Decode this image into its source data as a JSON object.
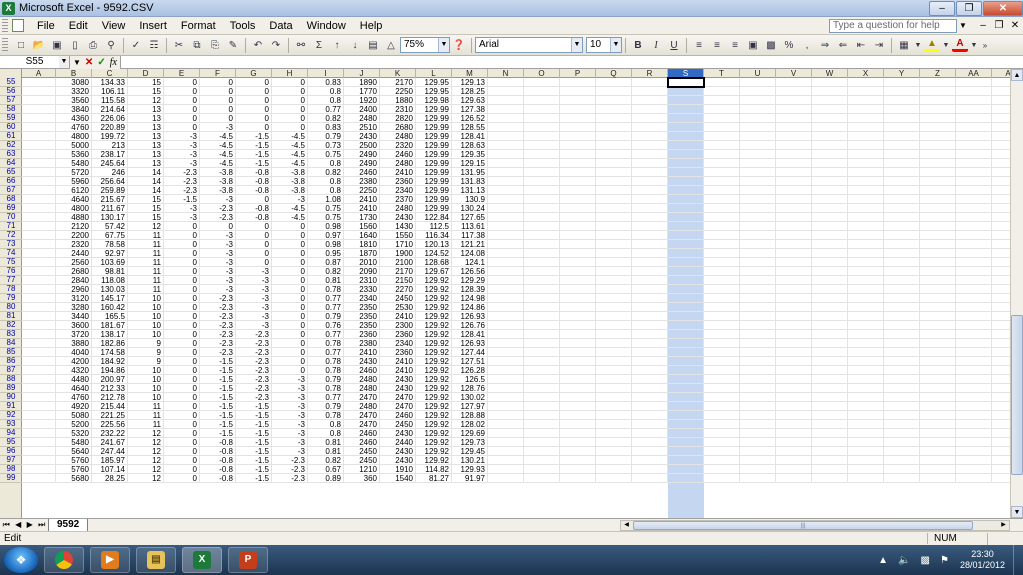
{
  "window": {
    "title": "Microsoft Excel - 9592.CSV",
    "icon": "excel-icon"
  },
  "menu": {
    "items": [
      "File",
      "Edit",
      "View",
      "Insert",
      "Format",
      "Tools",
      "Data",
      "Window",
      "Help"
    ],
    "help_placeholder": "Type a question for help"
  },
  "toolbar": {
    "zoom": "75%",
    "font": "Arial",
    "size": "10",
    "bold": "B",
    "italic": "I",
    "underline": "U",
    "sum": "Σ"
  },
  "formula_bar": {
    "name_box": "S55",
    "fx": "fx",
    "value": ""
  },
  "grid": {
    "columns": [
      "A",
      "B",
      "C",
      "D",
      "E",
      "F",
      "G",
      "H",
      "I",
      "J",
      "K",
      "L",
      "M",
      "N",
      "O",
      "P",
      "Q",
      "R",
      "S",
      "T",
      "U",
      "V",
      "W",
      "X",
      "Y",
      "Z",
      "AA",
      "A"
    ],
    "selected_column": "S",
    "selected_cell": "S55",
    "rows": [
      {
        "n": "55",
        "v": [
          "",
          "3080",
          "134.33",
          "15",
          "0",
          "0",
          "0",
          "0",
          "0.83",
          "1890",
          "2170",
          "129.95",
          "129.13"
        ]
      },
      {
        "n": "56",
        "v": [
          "",
          "3320",
          "106.11",
          "15",
          "0",
          "0",
          "0",
          "0",
          "0.8",
          "1770",
          "2250",
          "129.95",
          "128.25"
        ]
      },
      {
        "n": "57",
        "v": [
          "",
          "3560",
          "115.58",
          "12",
          "0",
          "0",
          "0",
          "0",
          "0.8",
          "1920",
          "1880",
          "129.98",
          "129.63"
        ]
      },
      {
        "n": "58",
        "v": [
          "",
          "3840",
          "214.64",
          "13",
          "0",
          "0",
          "0",
          "0",
          "0.77",
          "2400",
          "2310",
          "129.99",
          "127.38"
        ]
      },
      {
        "n": "59",
        "v": [
          "",
          "4360",
          "226.06",
          "13",
          "0",
          "0",
          "0",
          "0",
          "0.82",
          "2480",
          "2820",
          "129.99",
          "126.52"
        ]
      },
      {
        "n": "60",
        "v": [
          "",
          "4760",
          "220.89",
          "13",
          "0",
          "-3",
          "0",
          "0",
          "0.83",
          "2510",
          "2680",
          "129.99",
          "128.55"
        ]
      },
      {
        "n": "61",
        "v": [
          "",
          "4800",
          "199.72",
          "13",
          "-3",
          "-4.5",
          "-1.5",
          "-4.5",
          "0.79",
          "2430",
          "2480",
          "129.99",
          "128.41"
        ]
      },
      {
        "n": "62",
        "v": [
          "",
          "5000",
          "213",
          "13",
          "-3",
          "-4.5",
          "-1.5",
          "-4.5",
          "0.73",
          "2500",
          "2320",
          "129.99",
          "128.63"
        ]
      },
      {
        "n": "63",
        "v": [
          "",
          "5360",
          "238.17",
          "13",
          "-3",
          "-4.5",
          "-1.5",
          "-4.5",
          "0.75",
          "2490",
          "2460",
          "129.99",
          "129.35"
        ]
      },
      {
        "n": "64",
        "v": [
          "",
          "5480",
          "245.64",
          "13",
          "-3",
          "-4.5",
          "-1.5",
          "-4.5",
          "0.8",
          "2490",
          "2480",
          "129.99",
          "129.15"
        ]
      },
      {
        "n": "65",
        "v": [
          "",
          "5720",
          "246",
          "14",
          "-2.3",
          "-3.8",
          "-0.8",
          "-3.8",
          "0.82",
          "2460",
          "2410",
          "129.99",
          "131.95"
        ]
      },
      {
        "n": "66",
        "v": [
          "",
          "5960",
          "256.64",
          "14",
          "-2.3",
          "-3.8",
          "-0.8",
          "-3.8",
          "0.8",
          "2380",
          "2360",
          "129.99",
          "131.83"
        ]
      },
      {
        "n": "67",
        "v": [
          "",
          "6120",
          "259.89",
          "14",
          "-2.3",
          "-3.8",
          "-0.8",
          "-3.8",
          "0.8",
          "2250",
          "2340",
          "129.99",
          "131.13"
        ]
      },
      {
        "n": "68",
        "v": [
          "",
          "4640",
          "215.67",
          "15",
          "-1.5",
          "-3",
          "0",
          "-3",
          "1.08",
          "2410",
          "2370",
          "129.99",
          "130.9"
        ]
      },
      {
        "n": "69",
        "v": [
          "",
          "4800",
          "211.67",
          "15",
          "-3",
          "-2.3",
          "-0.8",
          "-4.5",
          "0.75",
          "2410",
          "2480",
          "129.99",
          "130.24"
        ]
      },
      {
        "n": "70",
        "v": [
          "",
          "4880",
          "130.17",
          "15",
          "-3",
          "-2.3",
          "-0.8",
          "-4.5",
          "0.75",
          "1730",
          "2430",
          "122.84",
          "127.65"
        ]
      },
      {
        "n": "71",
        "v": [
          "",
          "2120",
          "57.42",
          "12",
          "0",
          "0",
          "0",
          "0",
          "0.98",
          "1560",
          "1430",
          "112.5",
          "113.61"
        ]
      },
      {
        "n": "72",
        "v": [
          "",
          "2200",
          "67.75",
          "11",
          "0",
          "-3",
          "0",
          "0",
          "0.97",
          "1640",
          "1550",
          "116.34",
          "117.38"
        ]
      },
      {
        "n": "73",
        "v": [
          "",
          "2320",
          "78.58",
          "11",
          "0",
          "-3",
          "0",
          "0",
          "0.98",
          "1810",
          "1710",
          "120.13",
          "121.21"
        ]
      },
      {
        "n": "74",
        "v": [
          "",
          "2440",
          "92.97",
          "11",
          "0",
          "-3",
          "0",
          "0",
          "0.95",
          "1870",
          "1900",
          "124.52",
          "124.08"
        ]
      },
      {
        "n": "75",
        "v": [
          "",
          "2560",
          "103.69",
          "11",
          "0",
          "-3",
          "0",
          "0",
          "0.87",
          "2010",
          "2100",
          "128.68",
          "124.1"
        ]
      },
      {
        "n": "76",
        "v": [
          "",
          "2680",
          "98.81",
          "11",
          "0",
          "-3",
          "-3",
          "0",
          "0.82",
          "2090",
          "2170",
          "129.67",
          "126.56"
        ]
      },
      {
        "n": "77",
        "v": [
          "",
          "2840",
          "118.08",
          "11",
          "0",
          "-3",
          "-3",
          "0",
          "0.81",
          "2310",
          "2150",
          "129.92",
          "129.29"
        ]
      },
      {
        "n": "78",
        "v": [
          "",
          "2960",
          "130.03",
          "11",
          "0",
          "-3",
          "-3",
          "0",
          "0.78",
          "2330",
          "2270",
          "129.92",
          "128.39"
        ]
      },
      {
        "n": "79",
        "v": [
          "",
          "3120",
          "145.17",
          "10",
          "0",
          "-2.3",
          "-3",
          "0",
          "0.77",
          "2340",
          "2450",
          "129.92",
          "124.98"
        ]
      },
      {
        "n": "80",
        "v": [
          "",
          "3280",
          "160.42",
          "10",
          "0",
          "-2.3",
          "-3",
          "0",
          "0.77",
          "2350",
          "2530",
          "129.92",
          "124.86"
        ]
      },
      {
        "n": "81",
        "v": [
          "",
          "3440",
          "165.5",
          "10",
          "0",
          "-2.3",
          "-3",
          "0",
          "0.79",
          "2350",
          "2410",
          "129.92",
          "126.93"
        ]
      },
      {
        "n": "82",
        "v": [
          "",
          "3600",
          "181.67",
          "10",
          "0",
          "-2.3",
          "-3",
          "0",
          "0.76",
          "2350",
          "2300",
          "129.92",
          "126.76"
        ]
      },
      {
        "n": "83",
        "v": [
          "",
          "3720",
          "138.17",
          "10",
          "0",
          "-2.3",
          "-2.3",
          "0",
          "0.77",
          "2360",
          "2360",
          "129.92",
          "128.41"
        ]
      },
      {
        "n": "84",
        "v": [
          "",
          "3880",
          "182.86",
          "9",
          "0",
          "-2.3",
          "-2.3",
          "0",
          "0.78",
          "2380",
          "2340",
          "129.92",
          "126.93"
        ]
      },
      {
        "n": "85",
        "v": [
          "",
          "4040",
          "174.58",
          "9",
          "0",
          "-2.3",
          "-2.3",
          "0",
          "0.77",
          "2410",
          "2360",
          "129.92",
          "127.44"
        ]
      },
      {
        "n": "86",
        "v": [
          "",
          "4200",
          "184.92",
          "9",
          "0",
          "-1.5",
          "-2.3",
          "0",
          "0.78",
          "2430",
          "2410",
          "129.92",
          "127.51"
        ]
      },
      {
        "n": "87",
        "v": [
          "",
          "4320",
          "194.86",
          "10",
          "0",
          "-1.5",
          "-2.3",
          "0",
          "0.78",
          "2460",
          "2410",
          "129.92",
          "126.28"
        ]
      },
      {
        "n": "88",
        "v": [
          "",
          "4480",
          "200.97",
          "10",
          "0",
          "-1.5",
          "-2.3",
          "-3",
          "0.79",
          "2480",
          "2430",
          "129.92",
          "126.5"
        ]
      },
      {
        "n": "89",
        "v": [
          "",
          "4640",
          "212.33",
          "10",
          "0",
          "-1.5",
          "-2.3",
          "-3",
          "0.78",
          "2480",
          "2430",
          "129.92",
          "128.76"
        ]
      },
      {
        "n": "90",
        "v": [
          "",
          "4760",
          "212.78",
          "10",
          "0",
          "-1.5",
          "-2.3",
          "-3",
          "0.77",
          "2470",
          "2470",
          "129.92",
          "130.02"
        ]
      },
      {
        "n": "91",
        "v": [
          "",
          "4920",
          "215.44",
          "11",
          "0",
          "-1.5",
          "-1.5",
          "-3",
          "0.79",
          "2480",
          "2470",
          "129.92",
          "127.97"
        ]
      },
      {
        "n": "92",
        "v": [
          "",
          "5080",
          "221.25",
          "11",
          "0",
          "-1.5",
          "-1.5",
          "-3",
          "0.78",
          "2470",
          "2460",
          "129.92",
          "128.88"
        ]
      },
      {
        "n": "93",
        "v": [
          "",
          "5200",
          "225.56",
          "11",
          "0",
          "-1.5",
          "-1.5",
          "-3",
          "0.8",
          "2470",
          "2450",
          "129.92",
          "128.02"
        ]
      },
      {
        "n": "94",
        "v": [
          "",
          "5320",
          "232.22",
          "12",
          "0",
          "-1.5",
          "-1.5",
          "-3",
          "0.8",
          "2460",
          "2430",
          "129.92",
          "129.69"
        ]
      },
      {
        "n": "95",
        "v": [
          "",
          "5480",
          "241.67",
          "12",
          "0",
          "-0.8",
          "-1.5",
          "-3",
          "0.81",
          "2460",
          "2440",
          "129.92",
          "129.73"
        ]
      },
      {
        "n": "96",
        "v": [
          "",
          "5640",
          "247.44",
          "12",
          "0",
          "-0.8",
          "-1.5",
          "-3",
          "0.81",
          "2450",
          "2430",
          "129.92",
          "129.45"
        ]
      },
      {
        "n": "97",
        "v": [
          "",
          "5760",
          "185.97",
          "12",
          "0",
          "-0.8",
          "-1.5",
          "-2.3",
          "0.82",
          "2450",
          "2430",
          "129.92",
          "130.21"
        ]
      },
      {
        "n": "98",
        "v": [
          "",
          "5760",
          "107.14",
          "12",
          "0",
          "-0.8",
          "-1.5",
          "-2.3",
          "0.67",
          "1210",
          "1910",
          "114.82",
          "129.93"
        ]
      },
      {
        "n": "99",
        "v": [
          "",
          "5680",
          "28.25",
          "12",
          "0",
          "-0.8",
          "-1.5",
          "-2.3",
          "0.89",
          "360",
          "1540",
          "81.27",
          "91.97"
        ]
      }
    ]
  },
  "sheet": {
    "tab": "9592"
  },
  "status": {
    "mode": "Edit",
    "num": "NUM"
  },
  "taskbar": {
    "time": "23:30",
    "date": "28/01/2012"
  }
}
